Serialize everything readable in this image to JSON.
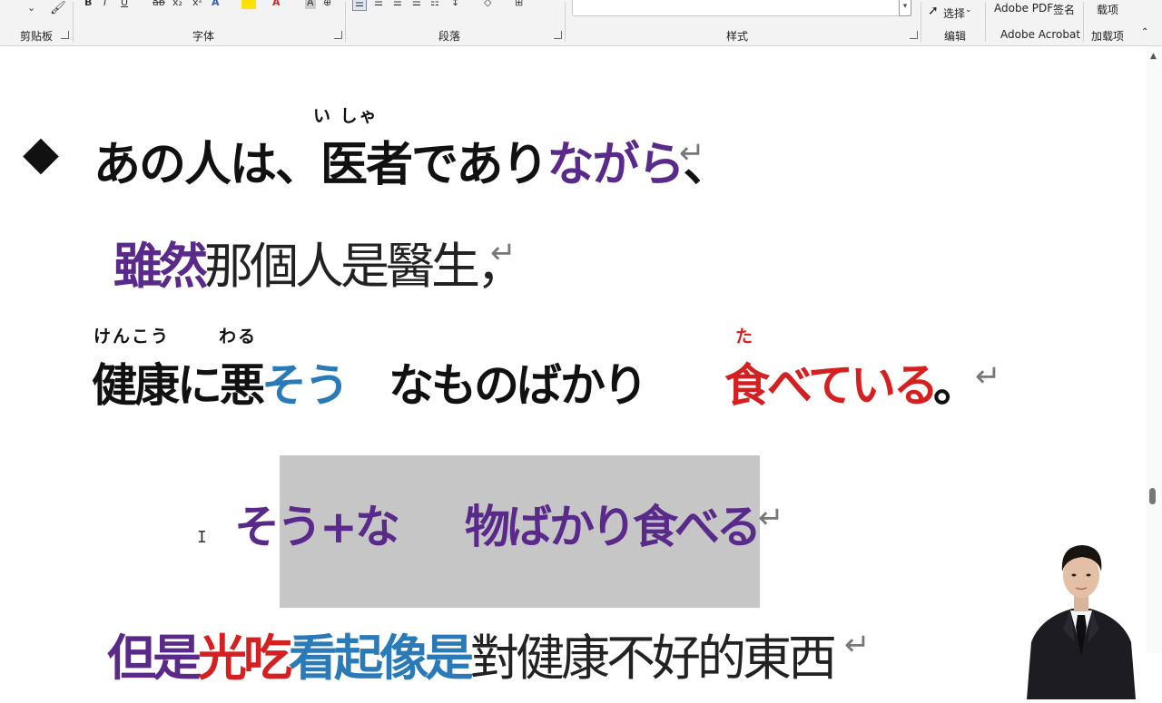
{
  "ribbon": {
    "groups": {
      "clipboard": "剪贴板",
      "font": "字体",
      "paragraph": "段落",
      "styles": "样式",
      "editing": "编辑",
      "adobe": "Adobe Acrobat",
      "addins": "加载项"
    },
    "select_label": "选择",
    "adobe_pdf": "Adobe PDF",
    "sign": "签名",
    "addins_top": "载项",
    "font_buttons": [
      "B",
      "I",
      "U",
      "ab",
      "x₂",
      "x²"
    ]
  },
  "document": {
    "line1": {
      "bullet": "◆",
      "part1": "あの人は、",
      "part2": "医者であり",
      "part3": "ながら",
      "part4": "、",
      "furigana": "い しゃ"
    },
    "line2": {
      "purple": "雖然",
      "rest": "那個人是醫生，"
    },
    "line3": {
      "part1": "健康に悪",
      "part2": "そう",
      "part3": "なものばかり",
      "part4": "食べている",
      "part5": "。",
      "furigana_kenkou": "けんこう",
      "furigana_waru": "わる",
      "furigana_ta": "た"
    },
    "line4": {
      "part1": "そう+な",
      "part2": "物ばかり食べる"
    },
    "line5_partial": {
      "purple": "但是",
      "red": "光吃",
      "blue1": "看起",
      "blue2": "像是",
      "rest": "對健康不好的東西"
    },
    "paragraph_mark": "↵"
  },
  "colors": {
    "purple": "#5a2a8a",
    "blue": "#2a7ab8",
    "red": "#d42020",
    "highlight_gray": "#c6c6c6"
  }
}
